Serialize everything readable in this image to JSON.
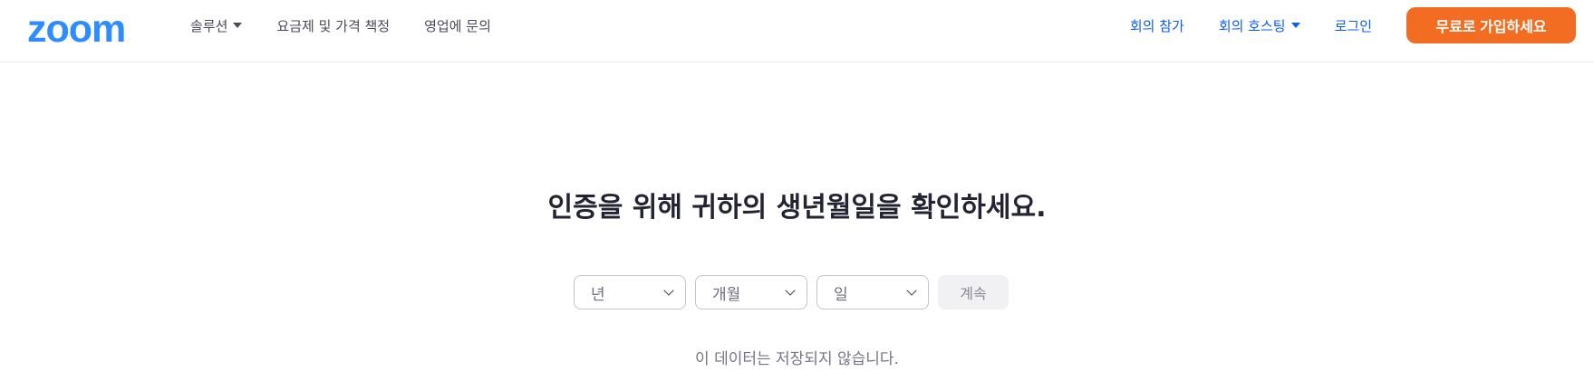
{
  "header": {
    "logo": "zoom",
    "nav_left": [
      {
        "label": "솔루션",
        "has_dropdown": true
      },
      {
        "label": "요금제 및 가격 책정",
        "has_dropdown": false
      },
      {
        "label": "영업에 문의",
        "has_dropdown": false
      }
    ],
    "nav_right": [
      {
        "label": "회의 참가",
        "has_dropdown": false
      },
      {
        "label": "회의 호스팅",
        "has_dropdown": true
      },
      {
        "label": "로그인",
        "has_dropdown": false
      }
    ],
    "signup_label": "무료로 가입하세요"
  },
  "main": {
    "title": "인증을 위해 귀하의 생년월일을 확인하세요.",
    "year_placeholder": "년",
    "month_placeholder": "개월",
    "day_placeholder": "일",
    "continue_label": "계속",
    "note": "이 데이터는 저장되지 않습니다."
  },
  "colors": {
    "brand_blue": "#2d8cff",
    "link_blue": "#0b5cff",
    "signup_orange": "#f26d21",
    "title_text": "#232333"
  }
}
